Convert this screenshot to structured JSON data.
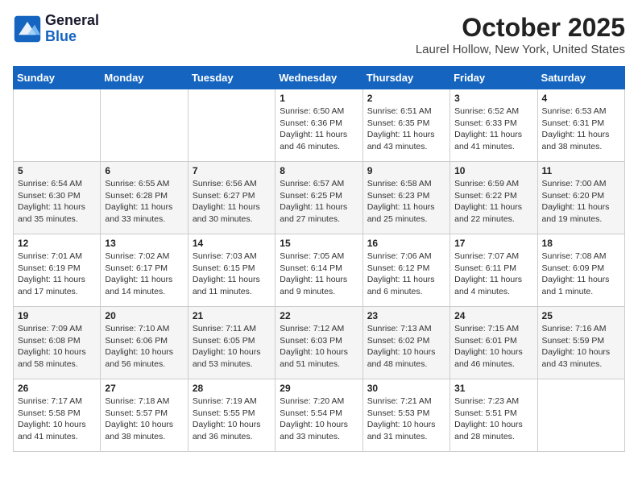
{
  "header": {
    "logo_line1": "General",
    "logo_line2": "Blue",
    "month": "October 2025",
    "location": "Laurel Hollow, New York, United States"
  },
  "days_of_week": [
    "Sunday",
    "Monday",
    "Tuesday",
    "Wednesday",
    "Thursday",
    "Friday",
    "Saturday"
  ],
  "weeks": [
    [
      {
        "num": "",
        "info": ""
      },
      {
        "num": "",
        "info": ""
      },
      {
        "num": "",
        "info": ""
      },
      {
        "num": "1",
        "info": "Sunrise: 6:50 AM\nSunset: 6:36 PM\nDaylight: 11 hours\nand 46 minutes."
      },
      {
        "num": "2",
        "info": "Sunrise: 6:51 AM\nSunset: 6:35 PM\nDaylight: 11 hours\nand 43 minutes."
      },
      {
        "num": "3",
        "info": "Sunrise: 6:52 AM\nSunset: 6:33 PM\nDaylight: 11 hours\nand 41 minutes."
      },
      {
        "num": "4",
        "info": "Sunrise: 6:53 AM\nSunset: 6:31 PM\nDaylight: 11 hours\nand 38 minutes."
      }
    ],
    [
      {
        "num": "5",
        "info": "Sunrise: 6:54 AM\nSunset: 6:30 PM\nDaylight: 11 hours\nand 35 minutes."
      },
      {
        "num": "6",
        "info": "Sunrise: 6:55 AM\nSunset: 6:28 PM\nDaylight: 11 hours\nand 33 minutes."
      },
      {
        "num": "7",
        "info": "Sunrise: 6:56 AM\nSunset: 6:27 PM\nDaylight: 11 hours\nand 30 minutes."
      },
      {
        "num": "8",
        "info": "Sunrise: 6:57 AM\nSunset: 6:25 PM\nDaylight: 11 hours\nand 27 minutes."
      },
      {
        "num": "9",
        "info": "Sunrise: 6:58 AM\nSunset: 6:23 PM\nDaylight: 11 hours\nand 25 minutes."
      },
      {
        "num": "10",
        "info": "Sunrise: 6:59 AM\nSunset: 6:22 PM\nDaylight: 11 hours\nand 22 minutes."
      },
      {
        "num": "11",
        "info": "Sunrise: 7:00 AM\nSunset: 6:20 PM\nDaylight: 11 hours\nand 19 minutes."
      }
    ],
    [
      {
        "num": "12",
        "info": "Sunrise: 7:01 AM\nSunset: 6:19 PM\nDaylight: 11 hours\nand 17 minutes."
      },
      {
        "num": "13",
        "info": "Sunrise: 7:02 AM\nSunset: 6:17 PM\nDaylight: 11 hours\nand 14 minutes."
      },
      {
        "num": "14",
        "info": "Sunrise: 7:03 AM\nSunset: 6:15 PM\nDaylight: 11 hours\nand 11 minutes."
      },
      {
        "num": "15",
        "info": "Sunrise: 7:05 AM\nSunset: 6:14 PM\nDaylight: 11 hours\nand 9 minutes."
      },
      {
        "num": "16",
        "info": "Sunrise: 7:06 AM\nSunset: 6:12 PM\nDaylight: 11 hours\nand 6 minutes."
      },
      {
        "num": "17",
        "info": "Sunrise: 7:07 AM\nSunset: 6:11 PM\nDaylight: 11 hours\nand 4 minutes."
      },
      {
        "num": "18",
        "info": "Sunrise: 7:08 AM\nSunset: 6:09 PM\nDaylight: 11 hours\nand 1 minute."
      }
    ],
    [
      {
        "num": "19",
        "info": "Sunrise: 7:09 AM\nSunset: 6:08 PM\nDaylight: 10 hours\nand 58 minutes."
      },
      {
        "num": "20",
        "info": "Sunrise: 7:10 AM\nSunset: 6:06 PM\nDaylight: 10 hours\nand 56 minutes."
      },
      {
        "num": "21",
        "info": "Sunrise: 7:11 AM\nSunset: 6:05 PM\nDaylight: 10 hours\nand 53 minutes."
      },
      {
        "num": "22",
        "info": "Sunrise: 7:12 AM\nSunset: 6:03 PM\nDaylight: 10 hours\nand 51 minutes."
      },
      {
        "num": "23",
        "info": "Sunrise: 7:13 AM\nSunset: 6:02 PM\nDaylight: 10 hours\nand 48 minutes."
      },
      {
        "num": "24",
        "info": "Sunrise: 7:15 AM\nSunset: 6:01 PM\nDaylight: 10 hours\nand 46 minutes."
      },
      {
        "num": "25",
        "info": "Sunrise: 7:16 AM\nSunset: 5:59 PM\nDaylight: 10 hours\nand 43 minutes."
      }
    ],
    [
      {
        "num": "26",
        "info": "Sunrise: 7:17 AM\nSunset: 5:58 PM\nDaylight: 10 hours\nand 41 minutes."
      },
      {
        "num": "27",
        "info": "Sunrise: 7:18 AM\nSunset: 5:57 PM\nDaylight: 10 hours\nand 38 minutes."
      },
      {
        "num": "28",
        "info": "Sunrise: 7:19 AM\nSunset: 5:55 PM\nDaylight: 10 hours\nand 36 minutes."
      },
      {
        "num": "29",
        "info": "Sunrise: 7:20 AM\nSunset: 5:54 PM\nDaylight: 10 hours\nand 33 minutes."
      },
      {
        "num": "30",
        "info": "Sunrise: 7:21 AM\nSunset: 5:53 PM\nDaylight: 10 hours\nand 31 minutes."
      },
      {
        "num": "31",
        "info": "Sunrise: 7:23 AM\nSunset: 5:51 PM\nDaylight: 10 hours\nand 28 minutes."
      },
      {
        "num": "",
        "info": ""
      }
    ]
  ]
}
